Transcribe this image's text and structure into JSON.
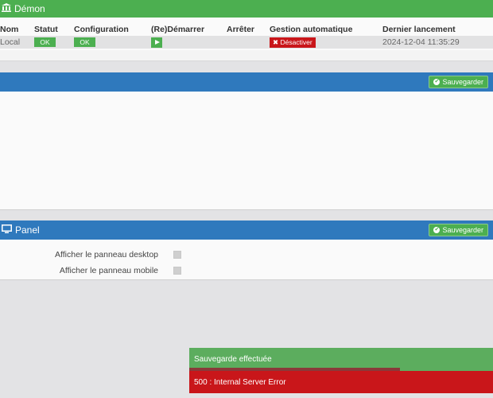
{
  "daemon": {
    "title": "Démon",
    "icon": "bank-icon",
    "columns": [
      "Nom",
      "Statut",
      "Configuration",
      "(Re)Démarrer",
      "Arrêter",
      "Gestion automatique",
      "Dernier lancement"
    ],
    "row": {
      "name": "Local",
      "status": "OK",
      "configuration": "OK",
      "restart_icon": "play-icon",
      "auto_button": "Désactiver",
      "last_launch": "2024-12-04 11:35:29"
    }
  },
  "config_panel": {
    "save_label": "Sauvegarder"
  },
  "panel": {
    "title": "Panel",
    "icon": "desktop-icon",
    "save_label": "Sauvegarder",
    "options": [
      {
        "label": "Afficher le panneau desktop",
        "checked": false
      },
      {
        "label": "Afficher le panneau mobile",
        "checked": false
      }
    ]
  },
  "toasts": {
    "success": "Sauvegarde effectuée",
    "error": "500 : Internal Server Error"
  },
  "colors": {
    "success": "#4caf50",
    "primary": "#2f79bd",
    "danger": "#c9161a"
  }
}
